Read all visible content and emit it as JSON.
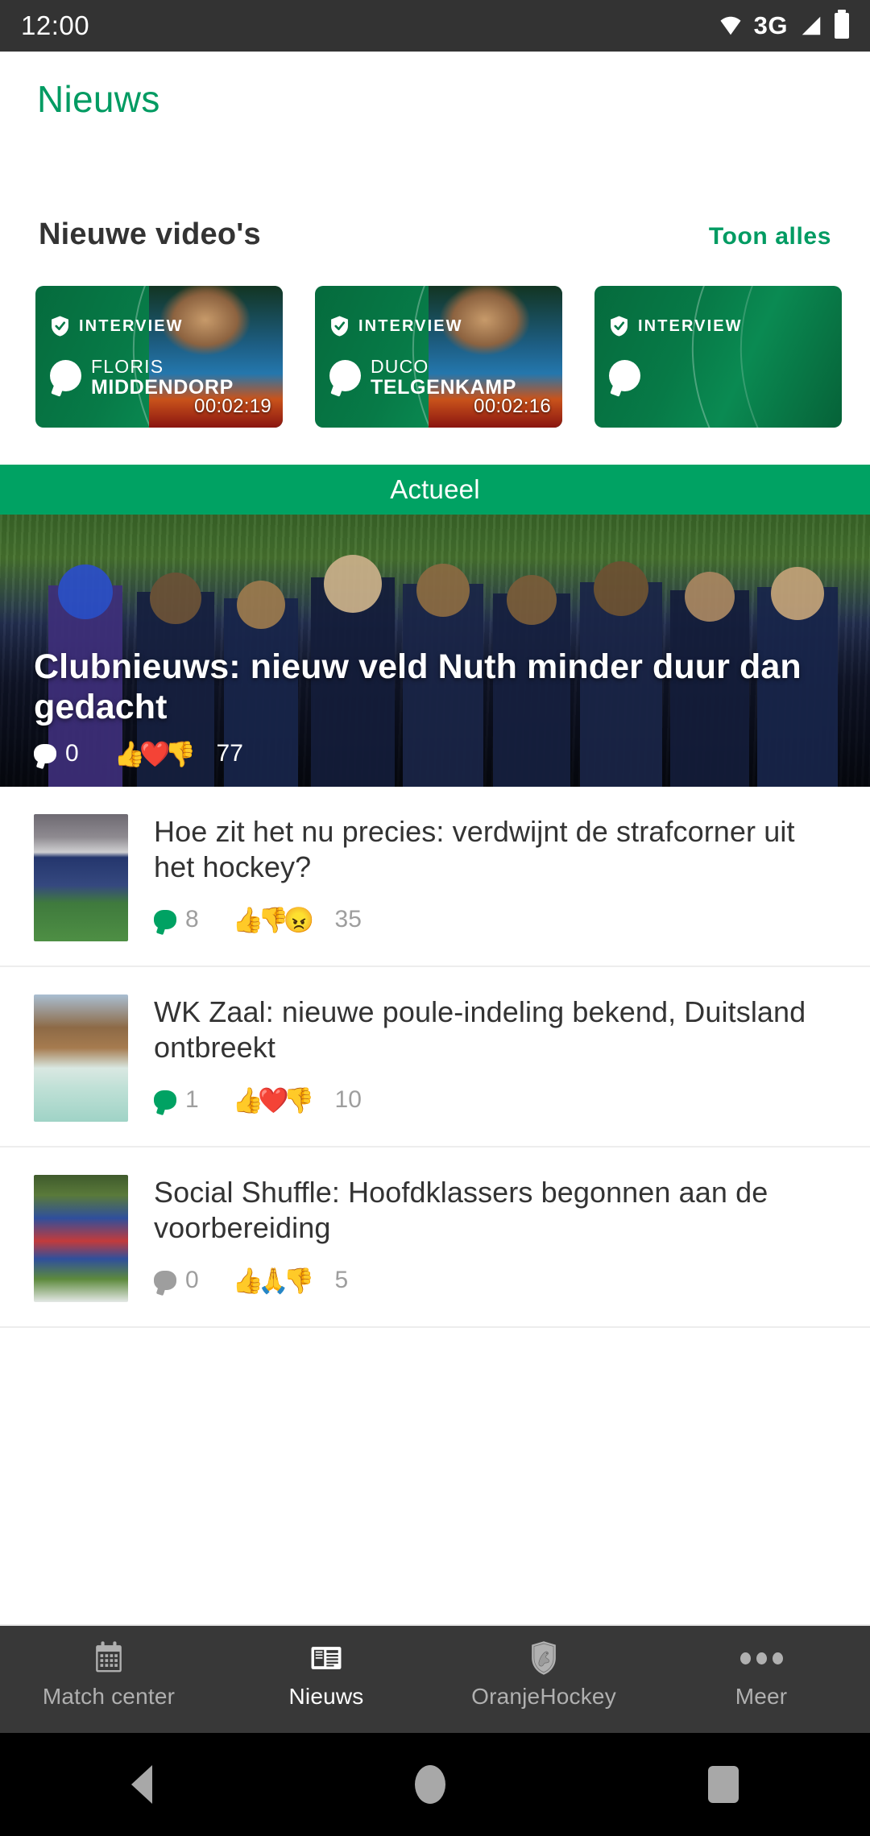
{
  "status_bar": {
    "time": "12:00",
    "network": "3G",
    "icons": [
      "wifi-icon",
      "signal-icon",
      "battery-icon"
    ]
  },
  "app_bar": {
    "title": "Nieuws",
    "accent_color": "#009b62"
  },
  "videos_section": {
    "title": "Nieuwe video's",
    "action_label": "Toon alles",
    "items": [
      {
        "badge": "INTERVIEW",
        "name_line1": "FLORIS",
        "name_line2": "MIDDENDORP",
        "duration": "00:02:19"
      },
      {
        "badge": "INTERVIEW",
        "name_line1": "DUCO",
        "name_line2": "TELGENKAMP",
        "duration": "00:02:16"
      },
      {
        "badge": "INTERVIEW",
        "name_line1": "",
        "name_line2": "",
        "duration": ""
      }
    ]
  },
  "actueel_banner": {
    "label": "Actueel",
    "color": "#00a263"
  },
  "featured": {
    "title": "Clubnieuws: nieuw veld Nuth minder duur dan gedacht",
    "comments": "0",
    "reactions": "77",
    "reaction_emojis": [
      "👍",
      "❤️",
      "👎"
    ]
  },
  "articles": [
    {
      "title": "Hoe zit het nu precies: verdwijnt de strafcorner uit het hockey?",
      "comments": "8",
      "reactions": "35",
      "reaction_emojis": [
        "👍",
        "👎",
        "😠"
      ],
      "comment_color": "green"
    },
    {
      "title": "WK Zaal: nieuwe poule-indeling bekend, Duitsland ontbreekt",
      "comments": "1",
      "reactions": "10",
      "reaction_emojis": [
        "👍",
        "❤️",
        "👎"
      ],
      "comment_color": "green"
    },
    {
      "title": "Social Shuffle: Hoofdklassers begonnen aan de voorbereiding",
      "comments": "0",
      "reactions": "5",
      "reaction_emojis": [
        "👍",
        "🙏",
        "👎"
      ],
      "comment_color": "grey"
    }
  ],
  "bottom_nav": {
    "items": [
      {
        "label": "Match center",
        "icon": "calendar-icon",
        "active": false
      },
      {
        "label": "Nieuws",
        "icon": "newspaper-icon",
        "active": true
      },
      {
        "label": "OranjeHockey",
        "icon": "shield-lion-icon",
        "active": false
      },
      {
        "label": "Meer",
        "icon": "more-dots-icon",
        "active": false
      }
    ]
  },
  "system_bar": {
    "back": "back-icon",
    "home": "home-icon",
    "recents": "recents-icon"
  }
}
